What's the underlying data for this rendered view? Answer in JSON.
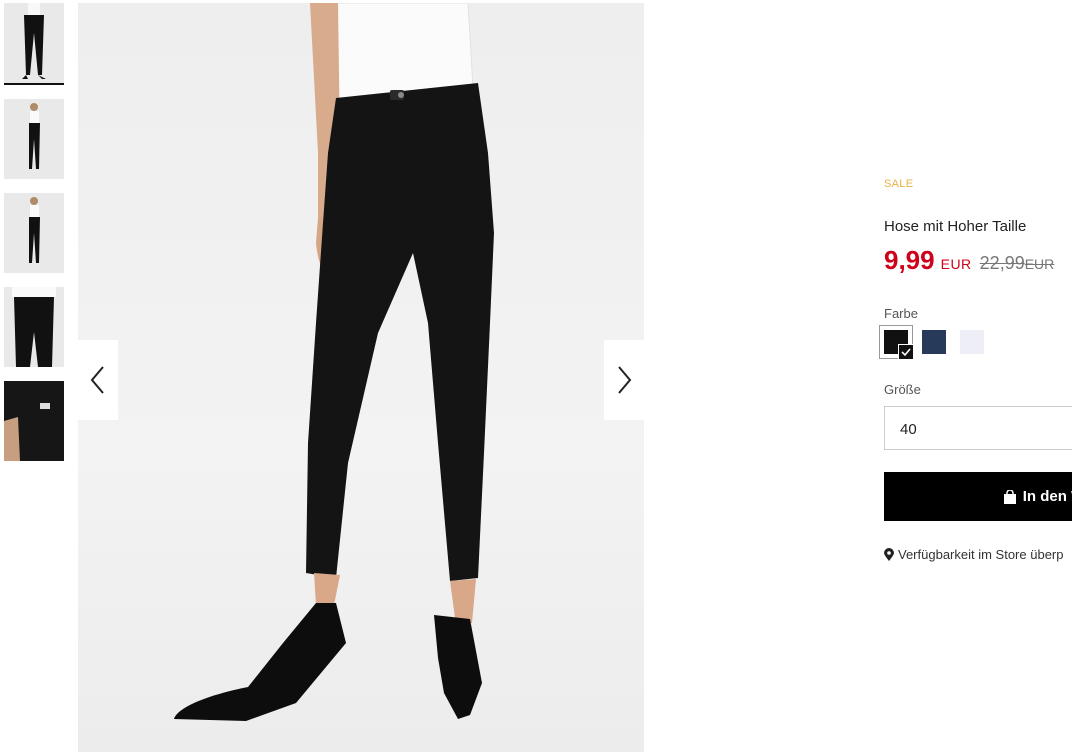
{
  "product": {
    "badge": "SALE",
    "title": "Hose mit Hoher Taille",
    "price_current": "9,99",
    "currency": "EUR",
    "price_old": "22,99",
    "currency_old": "EUR"
  },
  "color": {
    "label": "Farbe",
    "options": [
      {
        "name": "black",
        "hex": "#111111",
        "selected": true
      },
      {
        "name": "navy",
        "hex": "#273a5a",
        "selected": false
      },
      {
        "name": "light-lavender",
        "hex": "#eeeef7",
        "selected": false
      }
    ]
  },
  "size": {
    "label": "Größe",
    "value": "40"
  },
  "cart": {
    "label": "In den W",
    "icon": "shopping-bag-icon"
  },
  "store": {
    "icon": "location-pin-icon",
    "label": "Verfügbarkeit im Store überp"
  },
  "gallery": {
    "thumbnail_count": 5,
    "active_index": 0,
    "prev_icon": "chevron-left-icon",
    "next_icon": "chevron-right-icon"
  }
}
